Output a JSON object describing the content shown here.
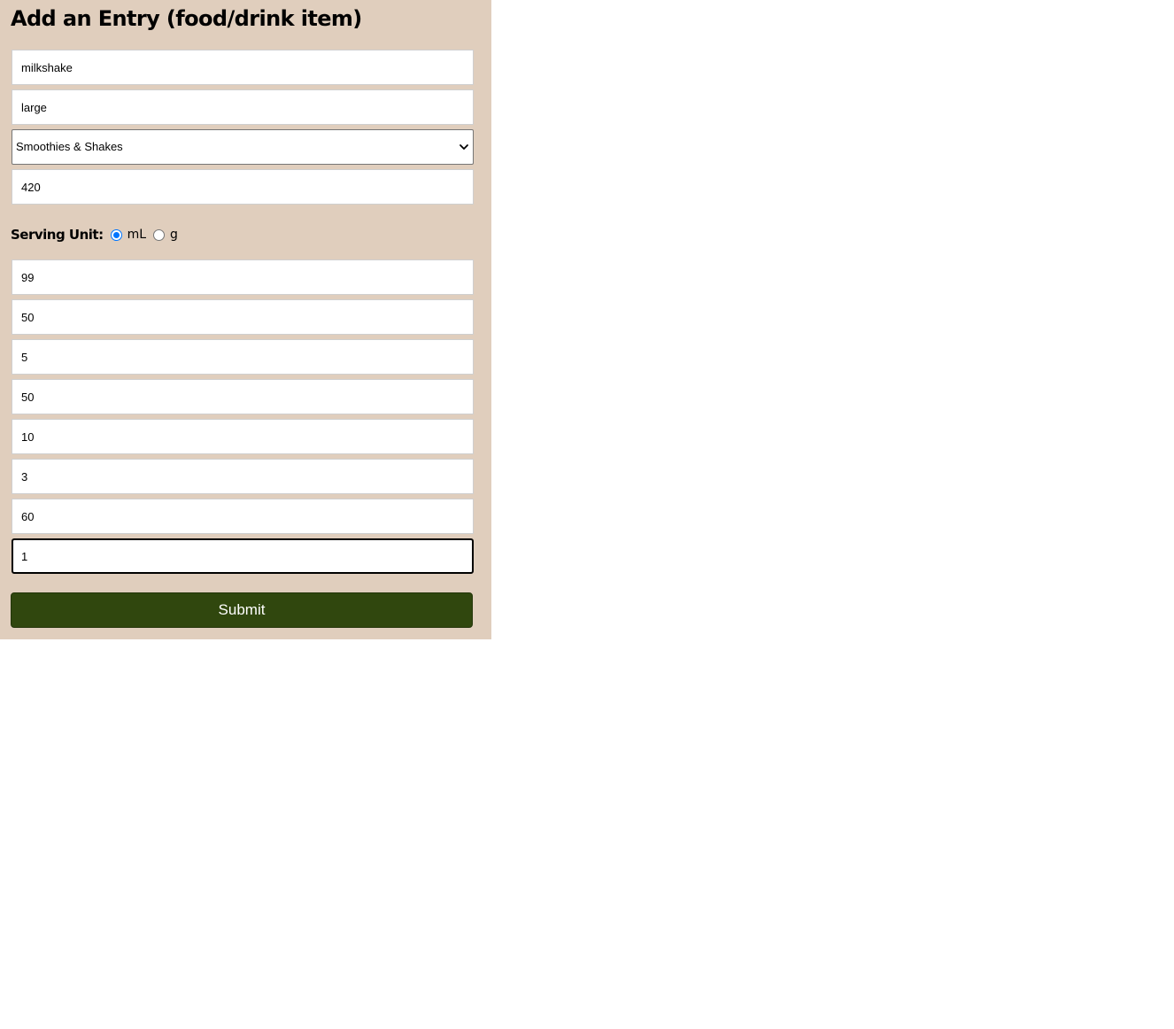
{
  "form": {
    "title": "Add an Entry (food/drink item)",
    "name_value": "milkshake",
    "size_value": "large",
    "category": {
      "selected": "Smoothies & Shakes"
    },
    "serving_size_value": "420",
    "serving_unit": {
      "label": "Serving Unit:",
      "options": [
        {
          "label": "mL",
          "checked": true
        },
        {
          "label": "g",
          "checked": false
        }
      ]
    },
    "nutrient_values": [
      "99",
      "50",
      "5",
      "50",
      "10",
      "3",
      "60",
      "1"
    ],
    "submit_label": "Submit"
  },
  "colors": {
    "panel_background": "#e0cebd",
    "submit_background": "#30470e",
    "radio_accent": "#0075ff"
  }
}
